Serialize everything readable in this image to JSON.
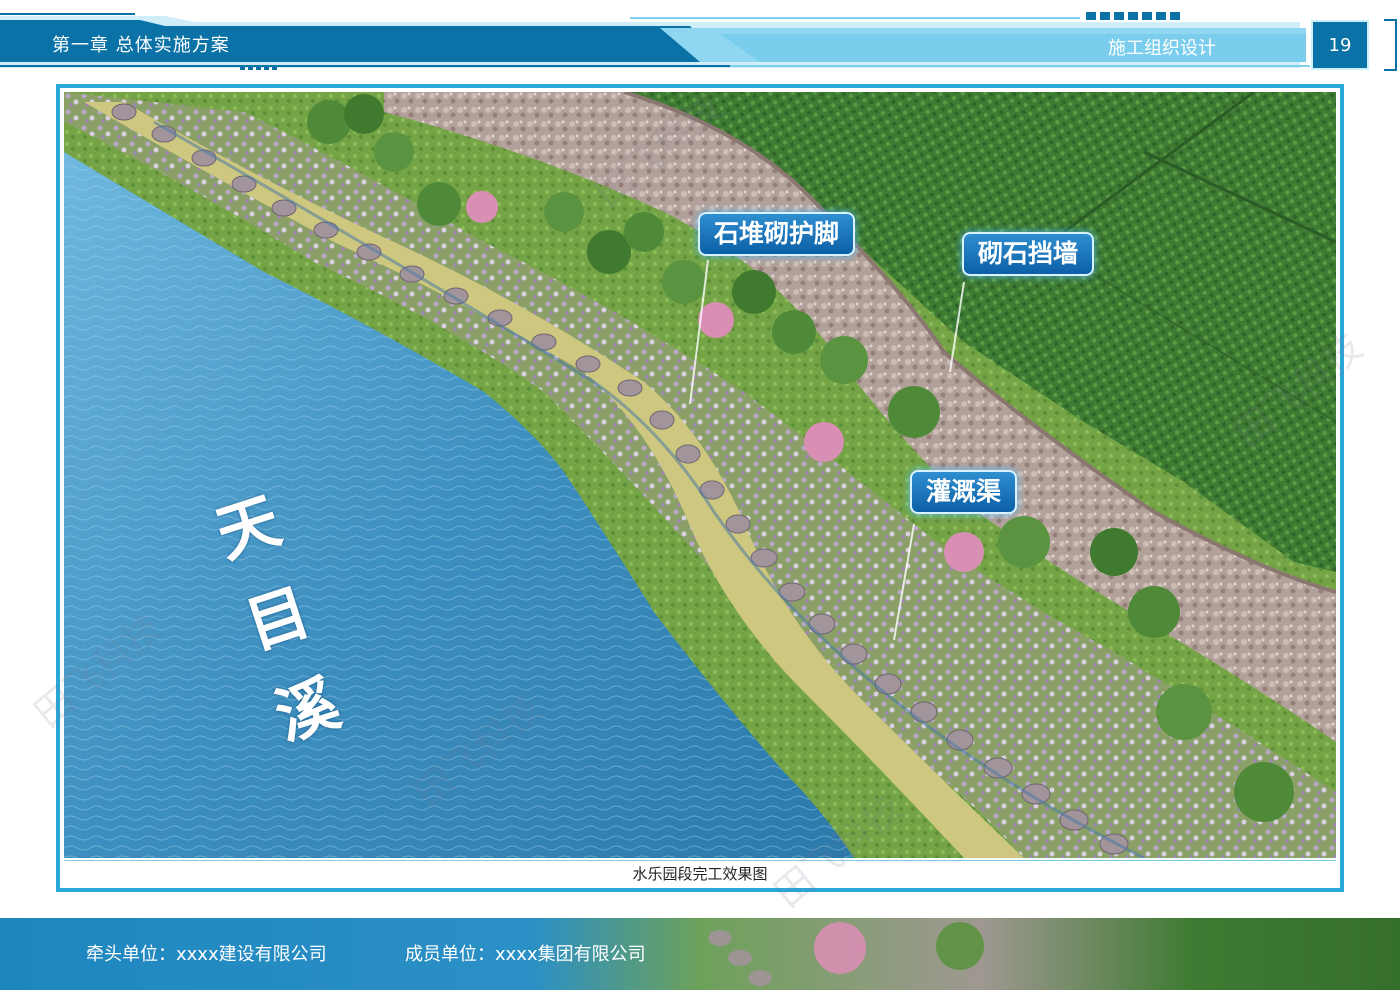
{
  "header": {
    "chapter": "第一章 总体实施方案",
    "section": "施工组织设计",
    "page_number": "19"
  },
  "figure": {
    "caption": "水乐园段完工效果图",
    "labels": {
      "stone_foot": "石堆砌护脚",
      "masonry_wall": "砌石挡墙",
      "irrigation_canal": "灌溉渠",
      "river_name": "天目溪"
    }
  },
  "footer": {
    "lead_unit": "牵头单位：xxxx建设有限公司",
    "member_unit": "成员单位：xxxx集团有限公司"
  },
  "watermark": "田飞科技",
  "colors": {
    "header_blue": "#0b72a7",
    "header_light": "#7fd0ef",
    "frame": "#2aa6d8",
    "callout": "#1471b8",
    "water": "#3d8fc0",
    "field": "#3f7d35",
    "stone": "#b4a29b"
  }
}
